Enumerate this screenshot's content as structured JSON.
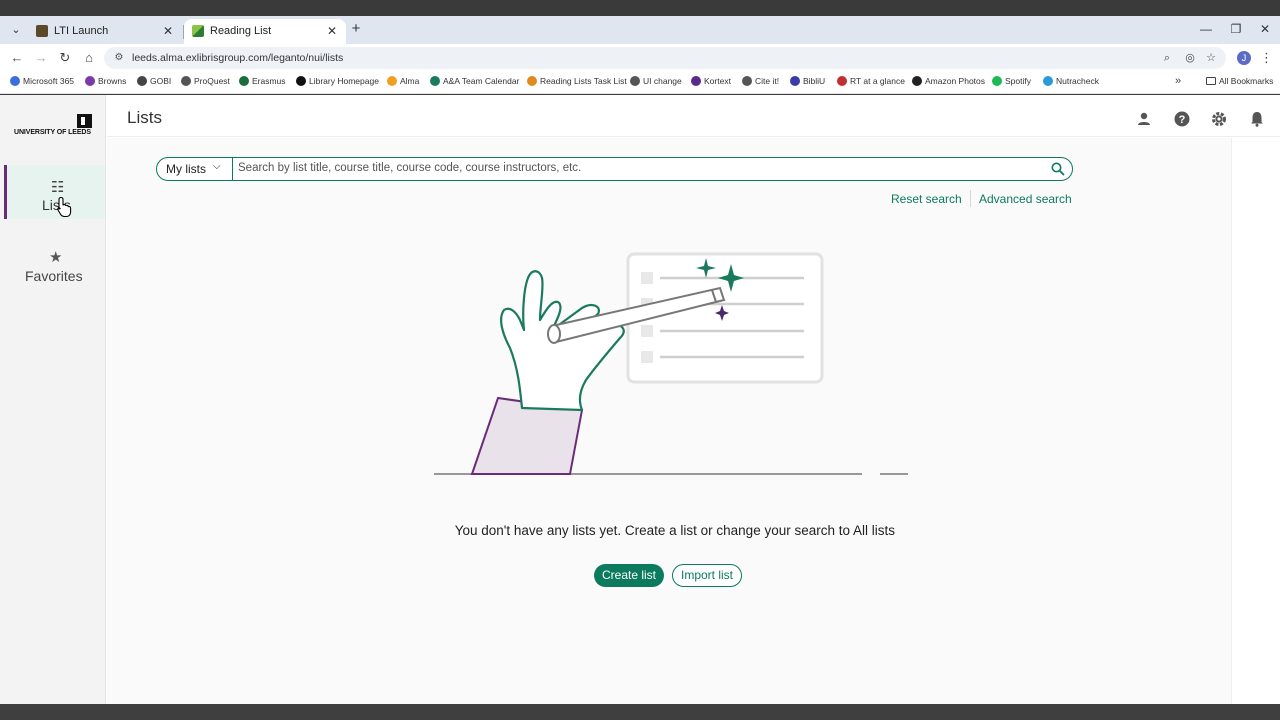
{
  "browser": {
    "tabs": [
      {
        "title": "LTI Launch",
        "active": false
      },
      {
        "title": "Reading List",
        "active": true
      }
    ],
    "url": "leeds.alma.exlibrisgroup.com/leganto/nui/lists",
    "profile_initial": "J",
    "bookmarks": [
      {
        "label": "Microsoft 365",
        "color": "#3b6fd8"
      },
      {
        "label": "Browns",
        "color": "#7b3aa8"
      },
      {
        "label": "GOBI",
        "color": "#444444"
      },
      {
        "label": "ProQuest",
        "color": "#555555"
      },
      {
        "label": "Erasmus",
        "color": "#1b6e3c"
      },
      {
        "label": "Library Homepage",
        "color": "#111111"
      },
      {
        "label": "Alma",
        "color": "#f0a020"
      },
      {
        "label": "A&A Team Calendar",
        "color": "#1a7a5e"
      },
      {
        "label": "Reading Lists Task List",
        "color": "#e08a1e"
      },
      {
        "label": "UI change",
        "color": "#555555"
      },
      {
        "label": "Kortext",
        "color": "#5a2a8a"
      },
      {
        "label": "Cite it!",
        "color": "#555555"
      },
      {
        "label": "BibliU",
        "color": "#3a3aa8"
      },
      {
        "label": "RT at a glance",
        "color": "#c03030"
      },
      {
        "label": "Amazon Photos",
        "color": "#222222"
      },
      {
        "label": "Spotify",
        "color": "#1db954"
      },
      {
        "label": "Nutracheck",
        "color": "#2a9ad8"
      }
    ],
    "all_bookmarks": "All Bookmarks"
  },
  "sidebar": {
    "logo_text": "UNIVERSITY OF LEEDS",
    "items": [
      {
        "label": "Lists",
        "icon": "list-icon",
        "active": true
      },
      {
        "label": "Favorites",
        "icon": "star-icon",
        "active": false
      }
    ]
  },
  "header": {
    "title": "Lists"
  },
  "search": {
    "scope": "My lists",
    "placeholder": "Search by list title, course title, course code, course instructors, etc.",
    "reset_label": "Reset search",
    "advanced_label": "Advanced search"
  },
  "empty_state": {
    "message": "You don't have any lists yet. Create a list or change your search to All lists",
    "create_label": "Create list",
    "import_label": "Import list"
  },
  "colors": {
    "accent": "#0b7a5e",
    "purple": "#6a2c78"
  }
}
